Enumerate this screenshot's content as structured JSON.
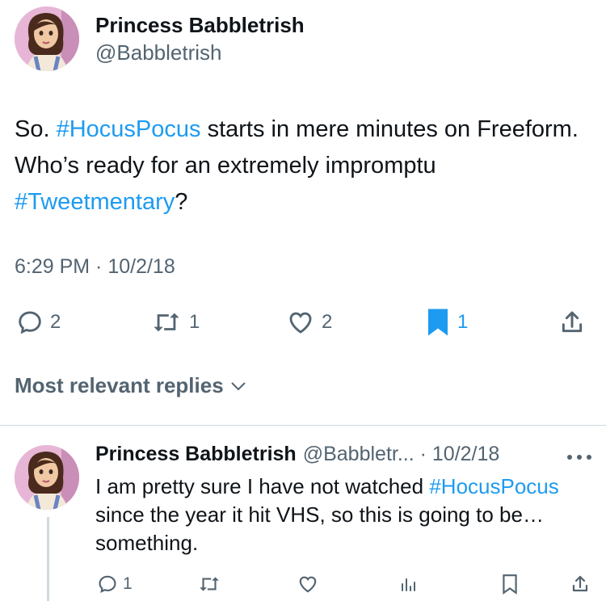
{
  "tweet": {
    "author_name": "Princess Babbletrish",
    "author_handle": "@Babbletrish",
    "text_parts": [
      "So. ",
      "#HocusPocus",
      " starts in mere minutes on Freeform. Who’s ready for an extremely impromptu ",
      "#Tweetmentary",
      "?"
    ],
    "timestamp": "6:29 PM · 10/2/18",
    "counts": {
      "replies": "2",
      "retweets": "1",
      "likes": "2",
      "bookmarks": "1"
    }
  },
  "replies_sort": {
    "label": "Most relevant replies"
  },
  "reply": {
    "author_name": "Princess Babbletrish",
    "meta": "@Babbletr... · 10/2/18",
    "text_parts": [
      "I am pretty sure I have not watched ",
      "#HocusPocus",
      " since the year it hit VHS, so this is going to be… something."
    ],
    "counts": {
      "replies": "1"
    }
  },
  "colors": {
    "accent": "#1d9bf0",
    "secondary_text": "#536471",
    "primary_text": "#0f1419",
    "divider": "#cfd9de"
  },
  "icons": [
    "reply-icon",
    "retweet-icon",
    "like-icon",
    "bookmark-icon",
    "share-icon",
    "more-icon",
    "chevron-down-icon",
    "views-icon"
  ]
}
